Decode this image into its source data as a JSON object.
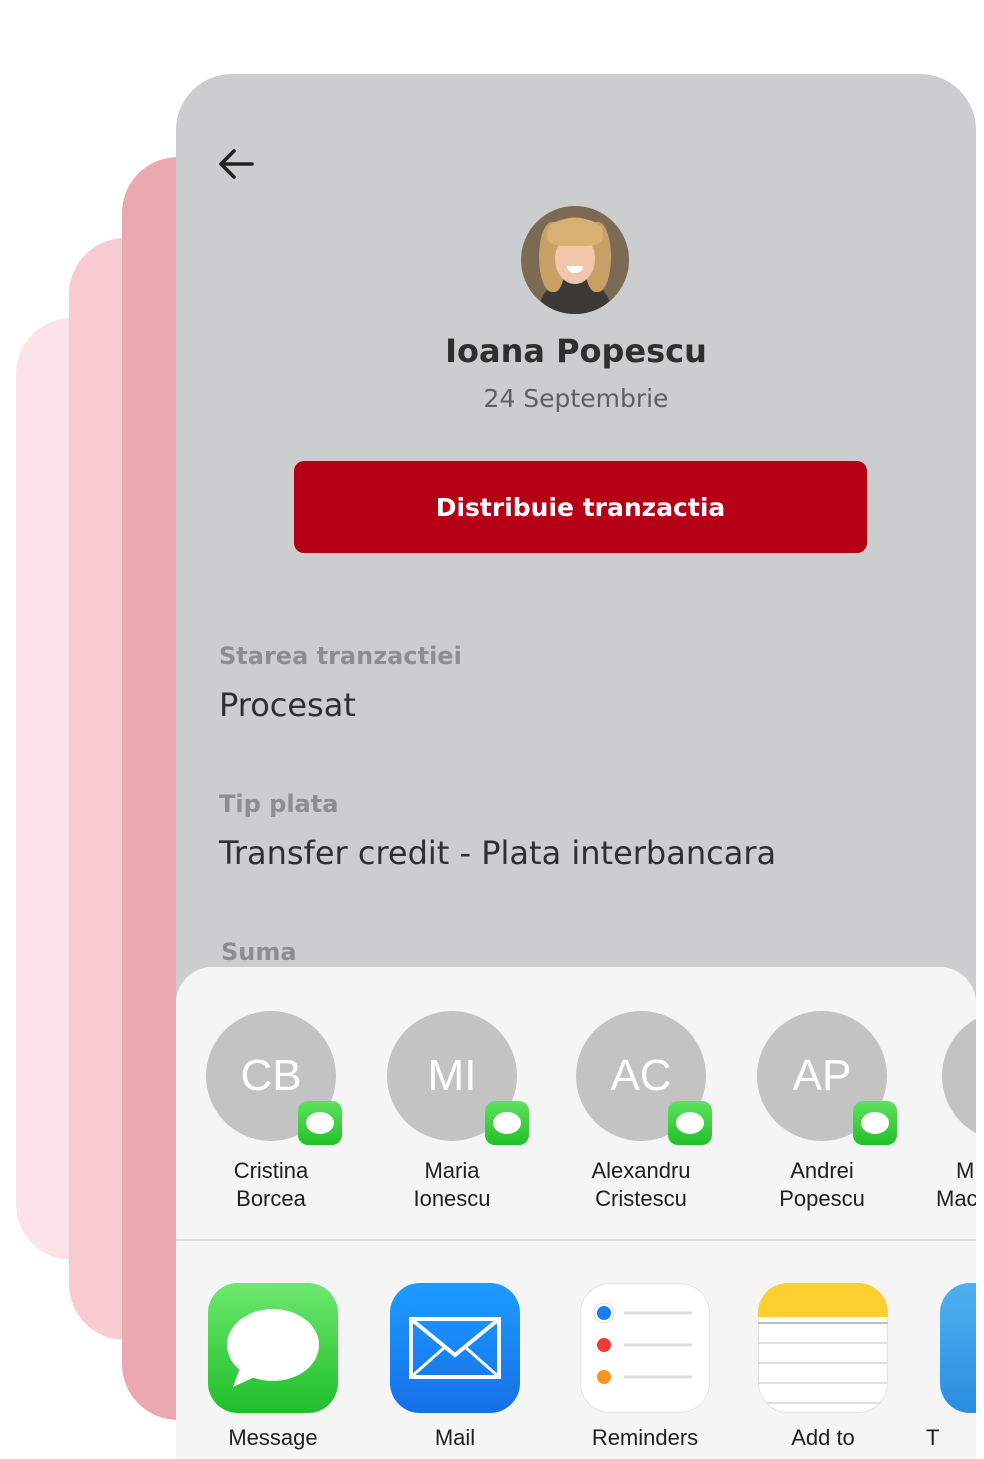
{
  "contact": {
    "name": "Ioana Popescu",
    "date": "24 Septembrie"
  },
  "actions": {
    "share_label": "Distribuie tranzactia"
  },
  "details": {
    "status_label": "Starea tranzactiei",
    "status_value": "Procesat",
    "type_label": "Tip plata",
    "type_value": "Transfer credit - Plata interbancara",
    "sum_label": "Suma"
  },
  "share_sheet": {
    "people": [
      {
        "initials": "CB",
        "first": "Cristina",
        "last": "Borcea",
        "badge_icon": "imessage-icon"
      },
      {
        "initials": "MI",
        "first": "Maria",
        "last": "Ionescu",
        "badge_icon": "imessage-icon"
      },
      {
        "initials": "AC",
        "first": "Alexandru",
        "last": "Cristescu",
        "badge_icon": "imessage-icon"
      },
      {
        "initials": "AP",
        "first": "Andrei",
        "last": "Popescu",
        "badge_icon": "imessage-icon"
      },
      {
        "initials": "",
        "first": "M",
        "last": "Mac",
        "badge_icon": "imessage-icon"
      }
    ],
    "apps": [
      {
        "label": "Message",
        "icon": "message-app-icon"
      },
      {
        "label": "Mail",
        "icon": "mail-app-icon"
      },
      {
        "label": "Reminders",
        "icon": "reminders-app-icon"
      },
      {
        "label": "Add to",
        "icon": "notes-app-icon"
      },
      {
        "label": "T",
        "icon": "twitter-app-icon"
      }
    ]
  },
  "colors": {
    "accent_red": "#b50015",
    "phone_bg": "#cccdce",
    "sheet_bg": "#f5f5f5",
    "contact_circle": "#c3c3c4",
    "imessage_green": "#22c02a"
  }
}
